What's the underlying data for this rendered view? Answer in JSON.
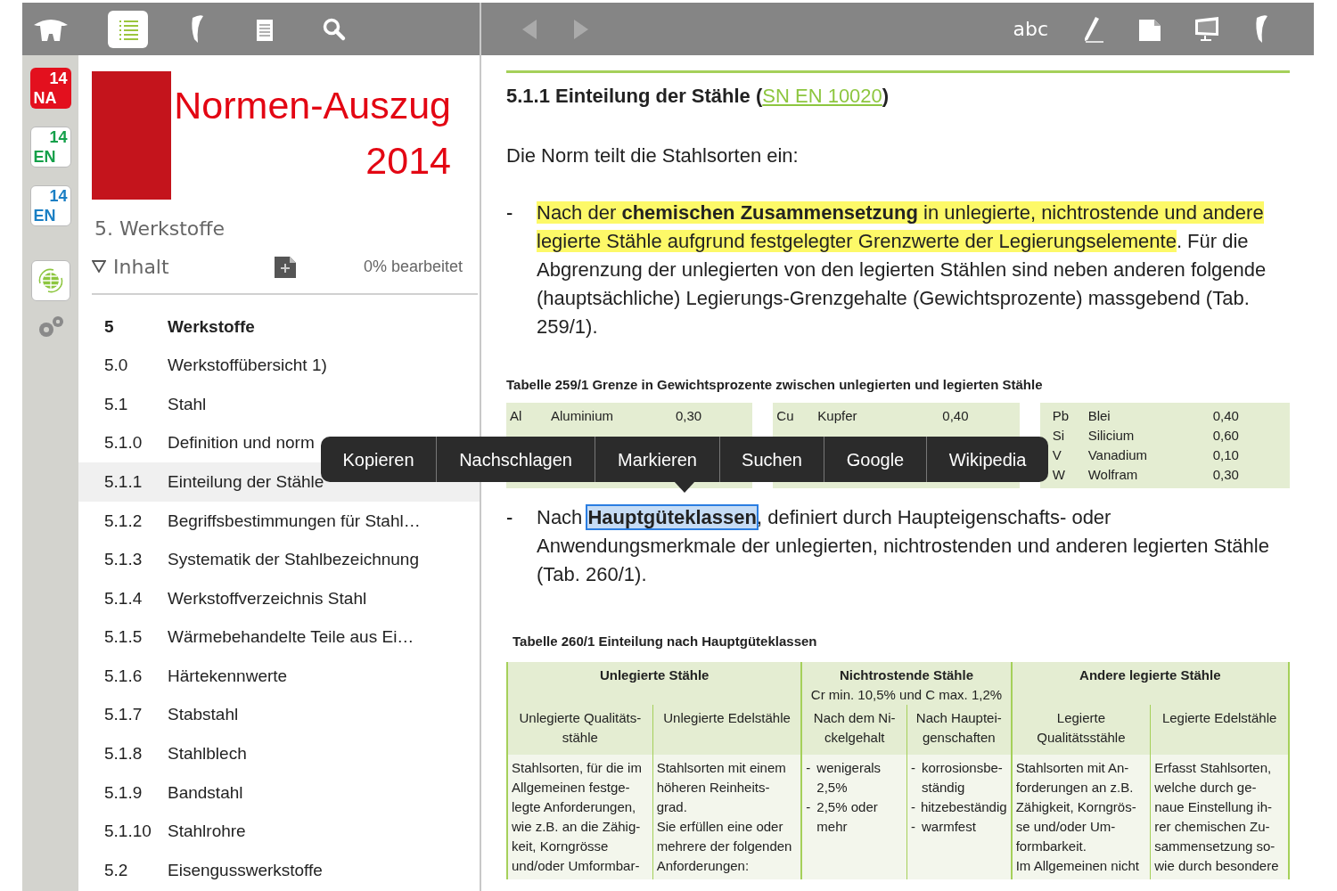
{
  "rail": {
    "badges": [
      {
        "number": "14",
        "code": "NA",
        "kind": "filled",
        "color": "#e3101e"
      },
      {
        "number": "14",
        "code": "EN",
        "kind": "outline",
        "color": "#14a04a"
      },
      {
        "number": "14",
        "code": "EN",
        "kind": "outline",
        "color": "#1a7fc4"
      }
    ]
  },
  "sidebar_toolbar": [
    {
      "kind": "list",
      "selected": true
    },
    {
      "kind": "bookmark",
      "selected": false
    },
    {
      "kind": "document",
      "selected": false
    },
    {
      "kind": "search",
      "selected": false
    }
  ],
  "main_toolbar": {
    "nav": [
      {
        "kind": "back"
      },
      {
        "kind": "forward"
      }
    ],
    "tools": [
      {
        "kind": "text",
        "label": "abc"
      },
      {
        "kind": "pencil"
      },
      {
        "kind": "note"
      },
      {
        "kind": "monitor"
      },
      {
        "kind": "bookmark"
      }
    ]
  },
  "book": {
    "title": "Normen-Auszug",
    "year": "2014",
    "chapter": "5. Werkstoffe",
    "contents_label": "Inhalt",
    "progress": "0% bearbeitet"
  },
  "toc": [
    {
      "number": "5",
      "title": "Werkstoffe",
      "bold": true,
      "selected": false
    },
    {
      "number": "5.0",
      "title": "Werkstoffübersicht 1)",
      "bold": false,
      "selected": false
    },
    {
      "number": "5.1",
      "title": "Stahl",
      "bold": false,
      "selected": false
    },
    {
      "number": "5.1.0",
      "title": "Definition und norm",
      "bold": false,
      "selected": false
    },
    {
      "number": "5.1.1",
      "title": "Einteilung der Stähle",
      "bold": false,
      "selected": true
    },
    {
      "number": "5.1.2",
      "title": "Begriffsbestimmungen für Stahl…",
      "bold": false,
      "selected": false
    },
    {
      "number": "5.1.3",
      "title": "Systematik der Stahlbezeichnung",
      "bold": false,
      "selected": false
    },
    {
      "number": "5.1.4",
      "title": "Werkstoffverzeichnis Stahl",
      "bold": false,
      "selected": false
    },
    {
      "number": "5.1.5",
      "title": "Wärmebehandelte Teile aus Ei…",
      "bold": false,
      "selected": false
    },
    {
      "number": "5.1.6",
      "title": "Härtekennwerte",
      "bold": false,
      "selected": false
    },
    {
      "number": "5.1.7",
      "title": "Stabstahl",
      "bold": false,
      "selected": false
    },
    {
      "number": "5.1.8",
      "title": "Stahlblech",
      "bold": false,
      "selected": false
    },
    {
      "number": "5.1.9",
      "title": "Bandstahl",
      "bold": false,
      "selected": false
    },
    {
      "number": "5.1.10",
      "title": "Stahlrohre",
      "bold": false,
      "selected": false
    },
    {
      "number": "5.2",
      "title": "Eisengusswerkstoffe",
      "bold": false,
      "selected": false
    }
  ],
  "document": {
    "heading": {
      "before": "5.1.1 Einteilung der Stähle (",
      "link": "SN EN 10020",
      "after": ")"
    },
    "intro": "Die Norm teilt die Stahlsorten ein:",
    "bullet_1": {
      "marker": "-",
      "segments": [
        {
          "text": "Nach der **chemischen Zusammensetzung** in unlegierte, nichtrostende und andere legierte Stähle aufgrund festgelegter Grenzwerte der Legierungselemente",
          "highlighted": true
        },
        {
          "text": ". Für die Abgrenzung der unlegierten von den legierten Stählen sind neben anderen folgende (hauptsächliche) Legierungs-Grenzgehalte (Gewichtsprozente) massgebend (Tab. 259/1).",
          "highlighted": false
        }
      ]
    },
    "table_259_title": "Tabelle 259/1 Grenze in Gewichtsprozente zwischen unlegierten und legierten Stähle",
    "table_259": [
      [
        {
          "symbol": "Al",
          "element": "Aluminium",
          "value": "0,30"
        }
      ],
      [
        {
          "symbol": "Cu",
          "element": "Kupfer",
          "value": "0,40"
        }
      ],
      [
        {
          "symbol": "Pb",
          "element": "Blei",
          "value": "0,40"
        },
        {
          "symbol": "Si",
          "element": "Silicium",
          "value": "0,60"
        },
        {
          "symbol": "V",
          "element": "Vanadium",
          "value": "0,10"
        },
        {
          "symbol": "W",
          "element": "Wolfram",
          "value": "0,30"
        }
      ]
    ],
    "bullet_2": {
      "marker": "-",
      "segments": [
        {
          "text": "Nach ",
          "selected": false
        },
        {
          "text": "**Hauptgüteklassen**",
          "selected": true
        },
        {
          "text": ", definiert durch Haupteigenschafts- oder Anwendungsmerkmale der unlegierten, nichtrostenden und anderen legierten Stähle (Tab. 260/1).",
          "selected": false
        }
      ]
    },
    "table_260_title": "Tabelle 260/1 Einteilung nach Hauptgüteklassen",
    "table_260": {
      "groups": [
        {
          "title": "Unlegierte Stähle"
        },
        {
          "title": "Nichtrostende Stähle",
          "note": "Cr min. 10,5% und C max. 1,2%"
        },
        {
          "title": "Andere legierte Stähle"
        }
      ],
      "columns": [
        "Unlegierte Qualitäts-\nstähle",
        "Unlegierte Edelstähle",
        "Nach dem Ni-\nckelgehalt",
        "Nach Hauptei-\ngenschaften",
        "Legierte\nQualitätsstähle",
        "Legierte Edelstähle"
      ],
      "cells": [
        {
          "kind": "text",
          "lines": [
            "Stahlsorten, für die im",
            "Allgemeinen festge-",
            "legte Anforderungen,",
            "wie z.B. an die Zähig-",
            "keit, Korngrösse",
            "und/oder Umformbar-"
          ]
        },
        {
          "kind": "text",
          "lines": [
            "Stahlsorten mit einem",
            "höheren Reinheits-",
            "grad.",
            "Sie erfüllen eine oder",
            "mehrere der folgenden",
            "Anforderungen:"
          ]
        },
        {
          "kind": "list",
          "items": [
            "wenigerals\n2,5%",
            "2,5% oder\nmehr"
          ]
        },
        {
          "kind": "list",
          "items": [
            "korrosionsbe-\nständig",
            "hitzebeständig",
            "warmfest"
          ]
        },
        {
          "kind": "text",
          "lines": [
            "Stahlsorten mit An-",
            "forderungen an z.B.",
            "Zähigkeit, Korngrös-",
            "se und/oder Um-",
            "formbarkeit.",
            "Im Allgemeinen nicht"
          ]
        },
        {
          "kind": "text",
          "lines": [
            "Erfasst Stahlsorten,",
            "welche durch ge-",
            "naue Einstellung ih-",
            "rer chemischen Zu-",
            "sammensetzung so-",
            "wie durch besondere"
          ]
        }
      ]
    }
  },
  "context_menu": [
    "Kopieren",
    "Nachschlagen",
    "Markieren",
    "Suchen",
    "Google",
    "Wikipedia"
  ]
}
